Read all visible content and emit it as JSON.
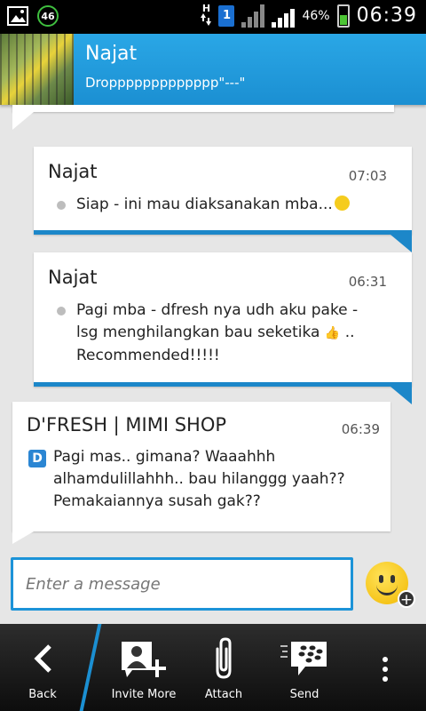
{
  "status_bar": {
    "notification_badge": "46",
    "network_type": "H",
    "sim_slot": "1",
    "battery_percent": "46%",
    "time": "06:39"
  },
  "header": {
    "contact_name": "Najat",
    "contact_status": "Droppppppppppppp\"---\""
  },
  "messages": [
    {
      "sender": "Najat",
      "time": "07:03",
      "lines": [
        "Siap - ini mau diaksanakan mba..."
      ]
    },
    {
      "sender": "Najat",
      "time": "06:31",
      "lines": [
        "Pagi mba - dfresh nya udh aku pake  -",
        "lsg menghilangkan bau seketika",
        "Recommended!!!!!"
      ],
      "line2_suffix": ".."
    },
    {
      "sender": "D'FRESH | MIMI SHOP",
      "time": "06:39",
      "app_badge": "D",
      "lines": [
        "Pagi mas.. gimana? Waaahhh",
        "alhamdulillahhh.. bau hilanggg yaah??",
        "Pemakaiannya susah gak??"
      ]
    }
  ],
  "composer": {
    "placeholder": "Enter a message"
  },
  "toolbar": {
    "back_label": "Back",
    "invite_label": "Invite More",
    "attach_label": "Attach",
    "send_label": "Send"
  },
  "colors": {
    "accent_blue": "#1b8fd2",
    "header_blue": "#2aa7e6",
    "toolbar_bg": "#1a1a1a",
    "chat_bg": "#e6e6e6"
  }
}
